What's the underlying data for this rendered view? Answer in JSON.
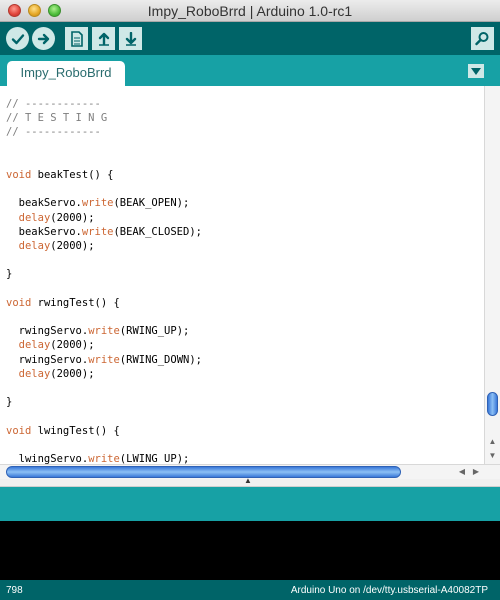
{
  "window": {
    "title": "Impy_RoboBrrd | Arduino 1.0-rc1"
  },
  "toolbar": {
    "buttons": [
      {
        "name": "verify",
        "icon": "checkmark-icon"
      },
      {
        "name": "upload",
        "icon": "right-arrow-icon"
      },
      {
        "name": "new",
        "icon": "new-file-icon"
      },
      {
        "name": "open",
        "icon": "up-arrow-icon"
      },
      {
        "name": "save",
        "icon": "down-arrow-icon"
      },
      {
        "name": "serial-monitor",
        "icon": "magnifier-icon"
      }
    ]
  },
  "tabs": [
    {
      "label": "Impy_RoboBrrd",
      "active": true
    }
  ],
  "editor": {
    "lines": [
      "// ------------",
      "// T E S T I N G",
      "// ------------",
      "",
      "",
      "void beakTest() {",
      "",
      "  beakServo.write(BEAK_OPEN);",
      "  delay(2000);",
      "  beakServo.write(BEAK_CLOSED);",
      "  delay(2000);",
      "",
      "}",
      "",
      "void rwingTest() {",
      "",
      "  rwingServo.write(RWING_UP);",
      "  delay(2000);",
      "  rwingServo.write(RWING_DOWN);",
      "  delay(2000);",
      "",
      "}",
      "",
      "void lwingTest() {",
      "",
      "  lwingServo.write(LWING_UP);"
    ]
  },
  "status": {
    "line_number": "798",
    "board": "Arduino Uno on /dev/tty.usbserial-A40082TP"
  },
  "colors": {
    "toolbar": "#006468",
    "tabstrip": "#17a1a5",
    "keyword": "#cc6633",
    "comment": "#7e7e7e"
  }
}
